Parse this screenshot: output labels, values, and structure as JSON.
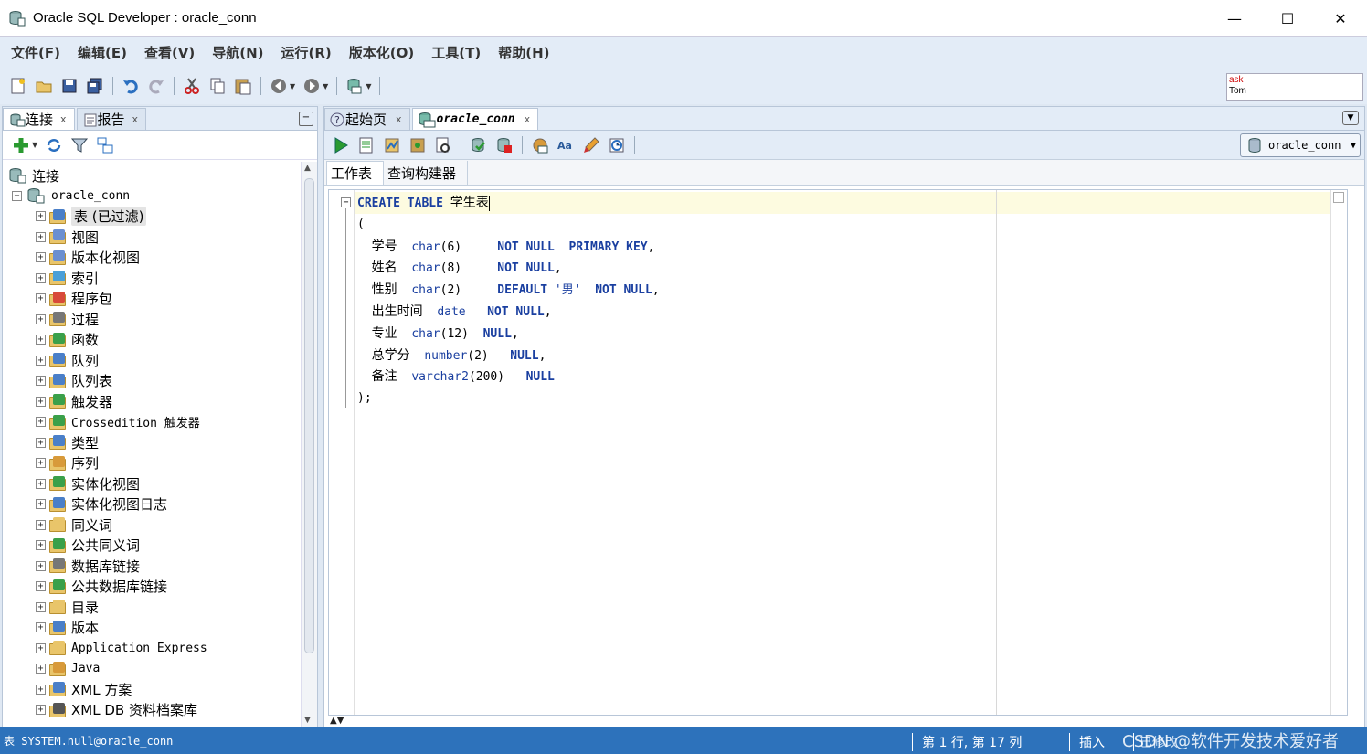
{
  "window": {
    "title": "Oracle SQL Developer : oracle_conn",
    "minimize": "—",
    "maximize": "☐",
    "close": "✕"
  },
  "menu": [
    "文件(F)",
    "编辑(E)",
    "查看(V)",
    "导航(N)",
    "运行(R)",
    "版本化(O)",
    "工具(T)",
    "帮助(H)"
  ],
  "ask_box": {
    "line1": "ask",
    "line2": "Tom"
  },
  "left_tabs": [
    {
      "label": "连接",
      "close": "x"
    },
    {
      "label": "报告",
      "close": "x"
    }
  ],
  "left_min": "−",
  "tree": {
    "root": "连接",
    "connection": "oracle_conn",
    "items": [
      {
        "label": "表 (已过滤)",
        "mono": false,
        "selected": true,
        "color": "#4a7fc8"
      },
      {
        "label": "视图",
        "mono": false,
        "color": "#6b8fd0"
      },
      {
        "label": "版本化视图",
        "mono": false,
        "color": "#6b8fd0"
      },
      {
        "label": "索引",
        "mono": false,
        "color": "#4a9fd8"
      },
      {
        "label": "程序包",
        "mono": false,
        "color": "#d84a3a"
      },
      {
        "label": "过程",
        "mono": false,
        "color": "#777"
      },
      {
        "label": "函数",
        "mono": false,
        "color": "#3aa04a"
      },
      {
        "label": "队列",
        "mono": false,
        "color": "#4a7fc8"
      },
      {
        "label": "队列表",
        "mono": false,
        "color": "#4a7fc8"
      },
      {
        "label": "触发器",
        "mono": false,
        "color": "#3aa04a"
      },
      {
        "label": "Crossedition 触发器",
        "mono": true,
        "color": "#3aa04a"
      },
      {
        "label": "类型",
        "mono": false,
        "color": "#4a7fc8"
      },
      {
        "label": "序列",
        "mono": false,
        "color": "#d89a3a"
      },
      {
        "label": "实体化视图",
        "mono": false,
        "color": "#3aa04a"
      },
      {
        "label": "实体化视图日志",
        "mono": false,
        "color": "#4a7fc8"
      },
      {
        "label": "同义词",
        "mono": false,
        "color": "#e9c56a"
      },
      {
        "label": "公共同义词",
        "mono": false,
        "color": "#3aa04a"
      },
      {
        "label": "数据库链接",
        "mono": false,
        "color": "#777"
      },
      {
        "label": "公共数据库链接",
        "mono": false,
        "color": "#3aa04a"
      },
      {
        "label": "目录",
        "mono": false,
        "color": "#e9c56a"
      },
      {
        "label": "版本",
        "mono": false,
        "color": "#4a7fc8"
      },
      {
        "label": "Application Express",
        "mono": true,
        "color": "#e9c56a"
      },
      {
        "label": "Java",
        "mono": true,
        "color": "#d89a3a"
      },
      {
        "label": "XML 方案",
        "mono": false,
        "color": "#4a7fc8"
      },
      {
        "label": "XML DB 资料档案库",
        "mono": false,
        "color": "#555"
      }
    ]
  },
  "right_tabs": [
    {
      "label": "起始页",
      "close": "x"
    },
    {
      "label": "oracle_conn",
      "close": "x"
    }
  ],
  "connection_select": "oracle_conn",
  "sub_tabs": [
    "工作表",
    "查询构建器"
  ],
  "fold_symbol": "−",
  "code": {
    "line1": {
      "kw1": "CREATE",
      "kw2": "TABLE",
      "name": "学生表"
    },
    "open": "(",
    "columns": [
      {
        "name": "学号",
        "pad": "  ",
        "type": "char",
        "args": "(6)",
        "gap": "     ",
        "rest": [
          {
            "t": "kw",
            "v": "NOT NULL"
          },
          {
            "t": "sp",
            "v": "  "
          },
          {
            "t": "kw",
            "v": "PRIMARY KEY"
          },
          {
            "t": "p",
            "v": ","
          }
        ]
      },
      {
        "name": "姓名",
        "pad": "  ",
        "type": "char",
        "args": "(8)",
        "gap": "     ",
        "rest": [
          {
            "t": "kw",
            "v": "NOT NULL"
          },
          {
            "t": "p",
            "v": ","
          }
        ]
      },
      {
        "name": "性别",
        "pad": "  ",
        "type": "char",
        "args": "(2)",
        "gap": "     ",
        "rest": [
          {
            "t": "kw",
            "v": "DEFAULT"
          },
          {
            "t": "sp",
            "v": " "
          },
          {
            "t": "str",
            "v": "'男'"
          },
          {
            "t": "sp",
            "v": "  "
          },
          {
            "t": "kw",
            "v": "NOT NULL"
          },
          {
            "t": "p",
            "v": ","
          }
        ]
      },
      {
        "name": "出生时间",
        "pad": "  ",
        "type": "date",
        "args": "",
        "gap": "   ",
        "rest": [
          {
            "t": "kw",
            "v": "NOT NULL"
          },
          {
            "t": "p",
            "v": ","
          }
        ]
      },
      {
        "name": "专业",
        "pad": "  ",
        "type": "char",
        "args": "(12)",
        "gap": "  ",
        "rest": [
          {
            "t": "kw",
            "v": "NULL"
          },
          {
            "t": "p",
            "v": ","
          }
        ]
      },
      {
        "name": "总学分",
        "pad": "  ",
        "type": "number",
        "args": "(2)",
        "gap": "   ",
        "rest": [
          {
            "t": "kw",
            "v": "NULL"
          },
          {
            "t": "p",
            "v": ","
          }
        ]
      },
      {
        "name": "备注",
        "pad": "  ",
        "type": "varchar2",
        "args": "(200)",
        "gap": "   ",
        "rest": [
          {
            "t": "kw",
            "v": "NULL"
          }
        ]
      }
    ],
    "close": ");"
  },
  "split_arrows": "▲▼",
  "status": {
    "left": "表 SYSTEM.null@oracle_conn",
    "position": "第 1 行, 第 17 列",
    "mode": "插入",
    "modified": "已修改",
    "watermark": "CSDN @软件开发技术爱好者"
  }
}
